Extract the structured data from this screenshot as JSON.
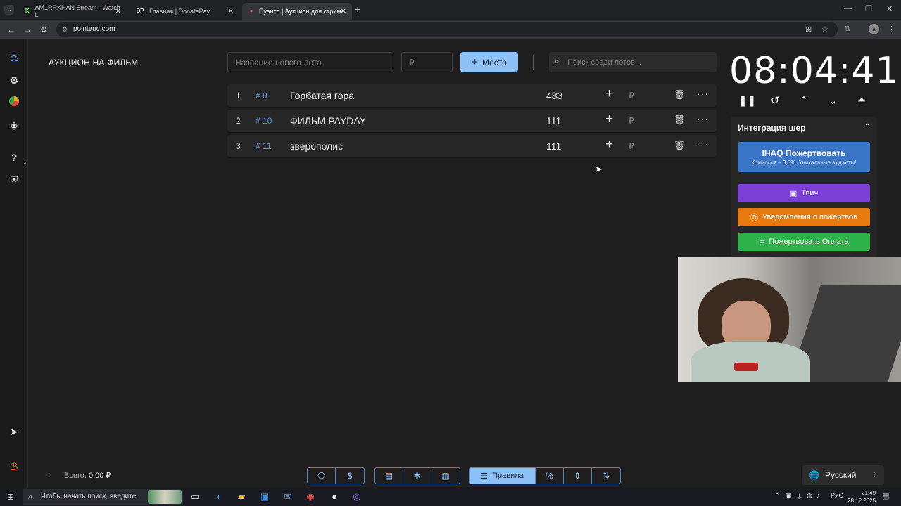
{
  "browser": {
    "tabs": [
      {
        "favicon": "K",
        "favicon_color": "#53fc18",
        "title": "AM1RRKHAN Stream - Watch L"
      },
      {
        "favicon": "DP",
        "favicon_color": "#ffffff",
        "title": "Главная | DonatePay"
      },
      {
        "favicon": "●",
        "favicon_color": "#e94f9a",
        "title": "Пуэнто | Аукцион для стриме"
      }
    ],
    "url": "pointauc.com"
  },
  "sidebar": {
    "icons": [
      "gavel-icon",
      "settings-icon",
      "pie-chart-icon",
      "layers-icon",
      "help-icon",
      "shield-icon",
      "telegram-icon",
      "brand-icon"
    ]
  },
  "auction": {
    "title": "АУКЦИОН НА ФИЛЬМ",
    "new_lot_placeholder": "Название нового лота",
    "amount_placeholder": "₽",
    "place_button": "Место",
    "search_placeholder": "Поиск среди лотов...",
    "lots": [
      {
        "index": "1",
        "id": "# 9",
        "name": "Горбатая гора",
        "amount": "483",
        "currency": "₽"
      },
      {
        "index": "2",
        "id": "# 10",
        "name": "ФИЛЬМ PAYDAY",
        "amount": "111",
        "currency": "₽"
      },
      {
        "index": "3",
        "id": "# 11",
        "name": "зверополис",
        "amount": "111",
        "currency": "₽"
      }
    ]
  },
  "timer": {
    "value": "08:04:41"
  },
  "integration": {
    "title": "Интеграция шер",
    "ihaq_label": "IHAQ Пожертвовать",
    "ihaq_sub": "Комиссия – 3,5%. Уникальные виджеты!",
    "twitch_label": "Твич",
    "alerts_label": "Уведомления о пожертвов",
    "donate_label": "Пожертвовать Оплата"
  },
  "footer": {
    "total_label": "Всего:",
    "total_value": "0,00 ₽",
    "rules_label": "Правила",
    "language": "Русский"
  },
  "taskbar": {
    "search_placeholder": "Чтобы начать поиск, введите",
    "lang": "РУС",
    "time": "21:49",
    "date": "28.12.2025"
  },
  "colors": {
    "accent": "#8ec1f5",
    "twitch": "#7c3fd6",
    "alerts": "#e8790e",
    "donate": "#2fb24c",
    "ihaq": "#3b76c6"
  }
}
